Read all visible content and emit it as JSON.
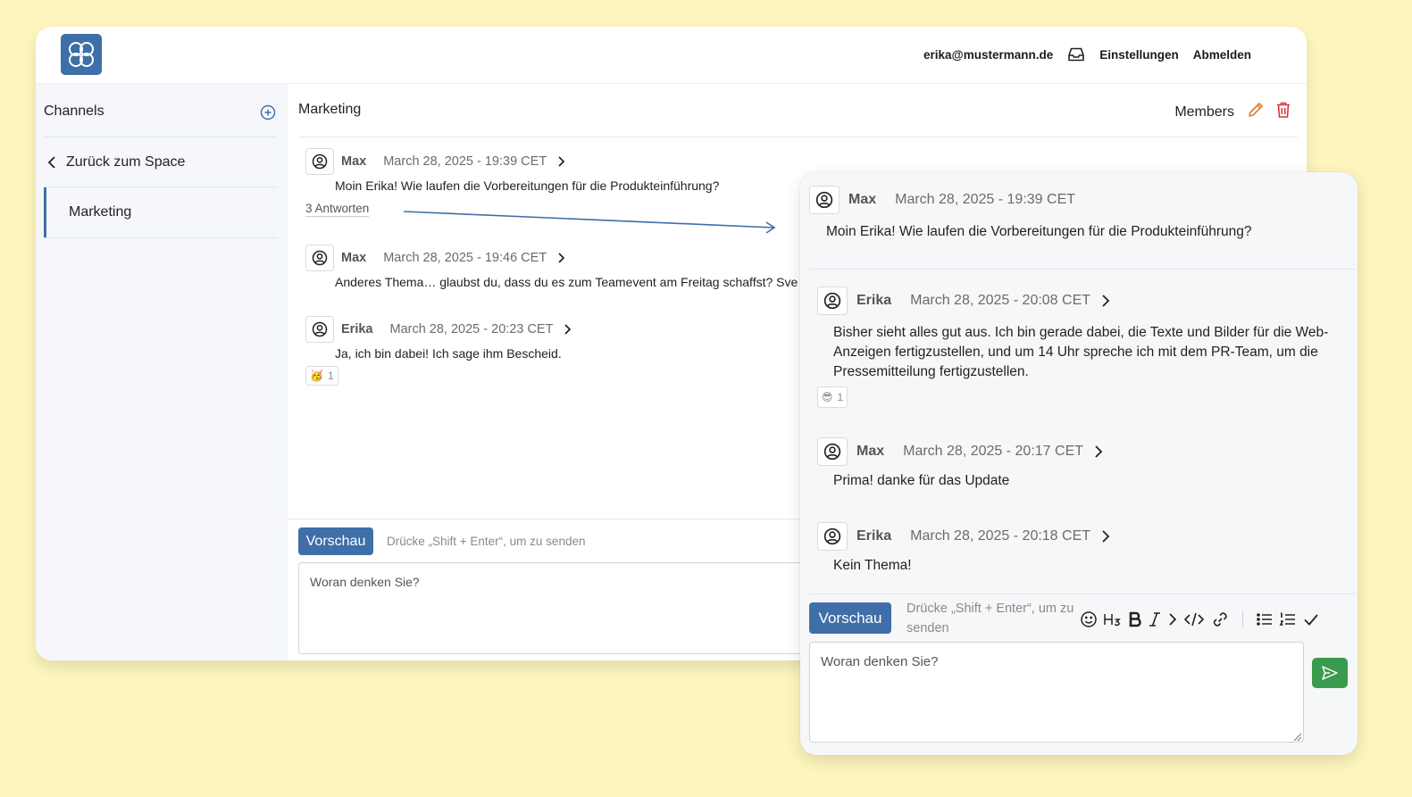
{
  "header": {
    "email": "erika@mustermann.de",
    "settings": "Einstellungen",
    "logout": "Abmelden"
  },
  "sidebar": {
    "title": "Channels",
    "back": "Zurück zum Space",
    "active_channel": "Marketing"
  },
  "channel": {
    "title": "Marketing",
    "members": "Members",
    "messages": [
      {
        "author": "Max",
        "time": "March 28, 2025 - 19:39 CET",
        "text": "Moin Erika! Wie laufen die Vorbereitungen für die Produkteinführung?",
        "replies": "3 Antworten"
      },
      {
        "author": "Max",
        "time": "March 28, 2025 - 19:46 CET",
        "text": "Anderes Thema… glaubst du, dass du es zum Teamevent am Freitag schaffst? Sve"
      },
      {
        "author": "Erika",
        "time": "March 28, 2025 - 20:23 CET",
        "text": "Ja, ich bin dabei! Ich sage ihm Bescheid.",
        "reaction": {
          "emoji": "🥳",
          "count": "1"
        }
      }
    ],
    "composer": {
      "preview": "Vorschau",
      "hint": "Drücke „Shift + Enter“, um zu senden",
      "placeholder": "Woran denken Sie?"
    }
  },
  "thread": {
    "root": {
      "author": "Max",
      "time": "March 28, 2025 - 19:39 CET",
      "text": "Moin Erika! Wie laufen die Vorbereitungen für die Produkteinführung?"
    },
    "replies": [
      {
        "author": "Erika",
        "time": "March 28, 2025 - 20:08 CET",
        "text": "Bisher sieht alles gut aus. Ich bin gerade dabei, die Texte und Bilder für die Web-Anzeigen fertigzustellen, und um 14 Uhr spreche ich mit dem PR-Team, um die Pressemitteilung fertigzustellen.",
        "reaction": {
          "emoji": "😎",
          "count": "1"
        }
      },
      {
        "author": "Max",
        "time": "March 28, 2025 - 20:17 CET",
        "text": "Prima! danke für das Update"
      },
      {
        "author": "Erika",
        "time": "March 28, 2025 - 20:18 CET",
        "text": "Kein Thema!"
      }
    ],
    "composer": {
      "preview": "Vorschau",
      "hint": "Drücke „Shift + Enter“, um zu senden",
      "placeholder": "Woran denken Sie?"
    }
  },
  "icons": {
    "logo": "clover-logo-icon",
    "accent": "#3f6fa8",
    "send_color": "#3a9a4e",
    "delete_color": "#d9363e",
    "edit_color": "#e07a2e"
  }
}
